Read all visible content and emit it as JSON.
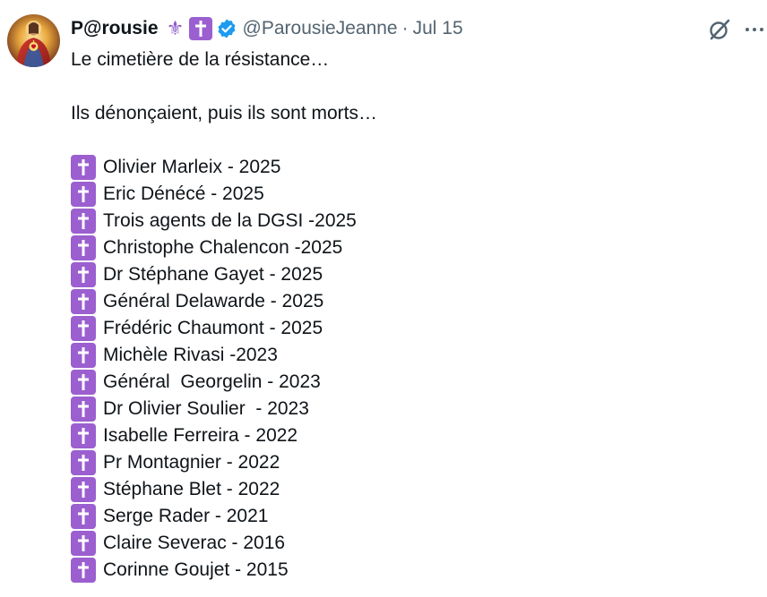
{
  "author": {
    "display_name": "P@rousie",
    "handle": "@ParousieJeanne",
    "separator": "·",
    "date": "Jul 15",
    "name_emojis": [
      "fleur-de-lis-icon",
      "latin-cross-icon"
    ],
    "verified": true
  },
  "actions": {
    "grok_icon": "grok-icon",
    "more_icon": "more-options-icon"
  },
  "tweet": {
    "intro": "Le cimetière de la résistance…",
    "subtitle": "Ils dénonçaient, puis ils sont morts…",
    "list_icon": "latin-cross-icon",
    "items": [
      "Olivier Marleix - 2025",
      "Eric Dénécé - 2025",
      "Trois agents de la DGSI -2025",
      "Christophe Chalencon -2025",
      "Dr Stéphane Gayet - 2025",
      "Général Delawarde - 2025",
      "Frédéric Chaumont - 2025",
      "Michèle Rivasi -2023",
      "Général  Georgelin - 2023",
      "Dr Olivier Soulier  - 2023",
      "Isabelle Ferreira - 2022",
      "Pr Montagnier - 2022",
      "Stéphane Blet - 2022",
      "Serge Rader - 2021",
      "Claire Severac - 2016",
      "Corinne Goujet - 2015"
    ]
  },
  "colors": {
    "text": "#0f1419",
    "muted": "#536471",
    "verified": "#1d9bf0",
    "cross_box": "#9b5fd0"
  }
}
